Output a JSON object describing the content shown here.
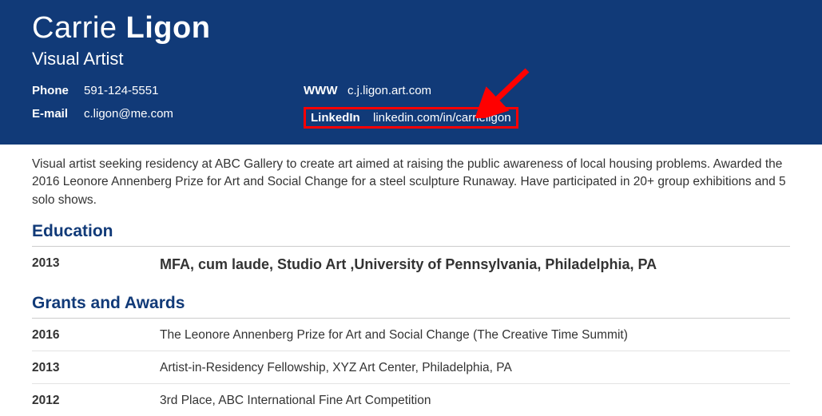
{
  "name": {
    "first": "Carrie",
    "last": "Ligon"
  },
  "title": "Visual Artist",
  "contacts": {
    "phone_label": "Phone",
    "phone": "591-124-5551",
    "email_label": "E-mail",
    "email": "c.ligon@me.com",
    "www_label": "WWW",
    "www": "c.j.ligon.art.com",
    "linkedin_label": "LinkedIn",
    "linkedin": "linkedin.com/in/carrieligon"
  },
  "summary": "Visual artist seeking residency at ABC Gallery to create art aimed at raising the public awareness of local housing problems. Awarded the 2016 Leonore Annenberg Prize for Art and Social Change for a steel sculpture Runaway. Have participated in 20+ group exhibitions and 5 solo shows.",
  "sections": {
    "education_title": "Education",
    "education": [
      {
        "year": "2013",
        "text": "MFA, cum laude, Studio Art ,University of Pennsylvania, Philadelphia, PA"
      }
    ],
    "grants_title": "Grants and Awards",
    "grants": [
      {
        "year": "2016",
        "text": "The Leonore Annenberg Prize for Art and Social Change (The Creative Time Summit)"
      },
      {
        "year": "2013",
        "text": "Artist-in-Residency Fellowship, XYZ Art Center, Philadelphia, PA"
      },
      {
        "year": "2012",
        "text": "3rd Place, ABC International Fine Art Competition"
      }
    ]
  },
  "annotation": {
    "arrow_color": "#ff0000",
    "highlight_color": "#ff0000"
  }
}
